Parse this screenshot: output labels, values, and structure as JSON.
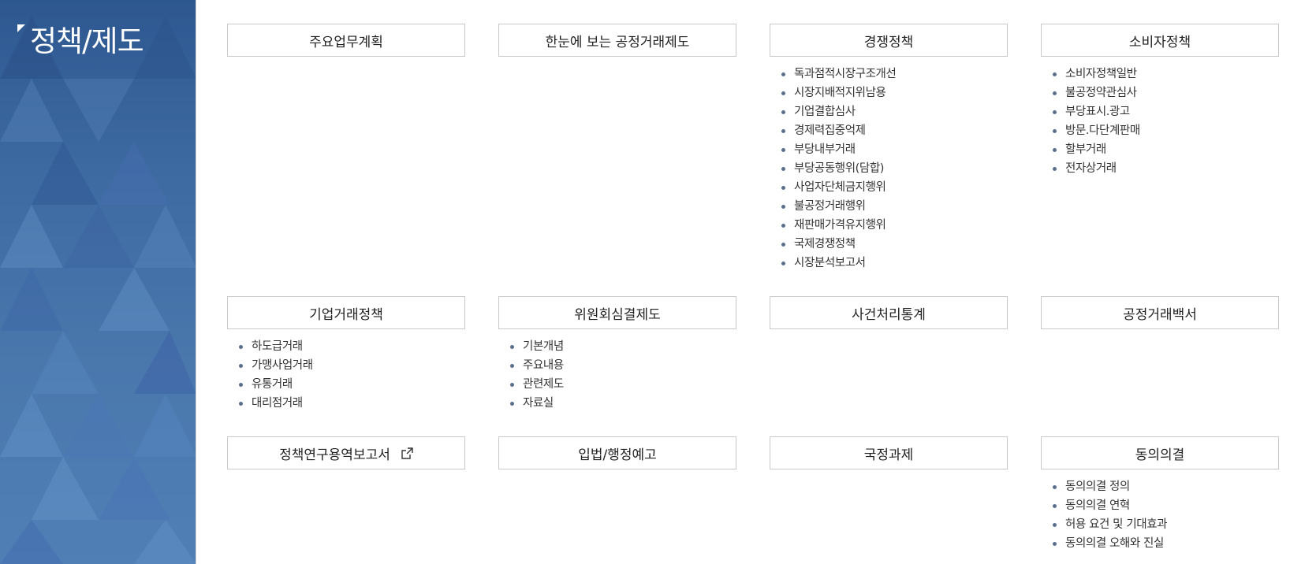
{
  "sidebar": {
    "title": "정책/제도"
  },
  "menus": [
    {
      "title": "주요업무계획",
      "items": []
    },
    {
      "title": "한눈에 보는 공정거래제도",
      "items": []
    },
    {
      "title": "경쟁정책",
      "items": [
        "독과점적시장구조개선",
        "시장지배적지위남용",
        "기업결합심사",
        "경제력집중억제",
        "부당내부거래",
        "부당공동행위(담합)",
        "사업자단체금지행위",
        "불공정거래행위",
        "재판매가격유지행위",
        "국제경쟁정책",
        "시장분석보고서"
      ]
    },
    {
      "title": "소비자정책",
      "items": [
        "소비자정책일반",
        "불공정약관심사",
        "부당표시.광고",
        "방문.다단계판매",
        "할부거래",
        "전자상거래"
      ]
    },
    {
      "title": "기업거래정책",
      "items": [
        "하도급거래",
        "가맹사업거래",
        "유통거래",
        "대리점거래"
      ]
    },
    {
      "title": "위원회심결제도",
      "items": [
        "기본개념",
        "주요내용",
        "관련제도",
        "자료실"
      ]
    },
    {
      "title": "사건처리통계",
      "items": []
    },
    {
      "title": "공정거래백서",
      "items": []
    },
    {
      "title": "정책연구용역보고서",
      "items": [],
      "icon": "external-link-icon"
    },
    {
      "title": "입법/행정예고",
      "items": []
    },
    {
      "title": "국정과제",
      "items": []
    },
    {
      "title": "동의의결",
      "items": [
        "동의의결 정의",
        "동의의결 연혁",
        "허용 요건 및 기대효과",
        "동의의결 오해와 진실"
      ]
    }
  ]
}
